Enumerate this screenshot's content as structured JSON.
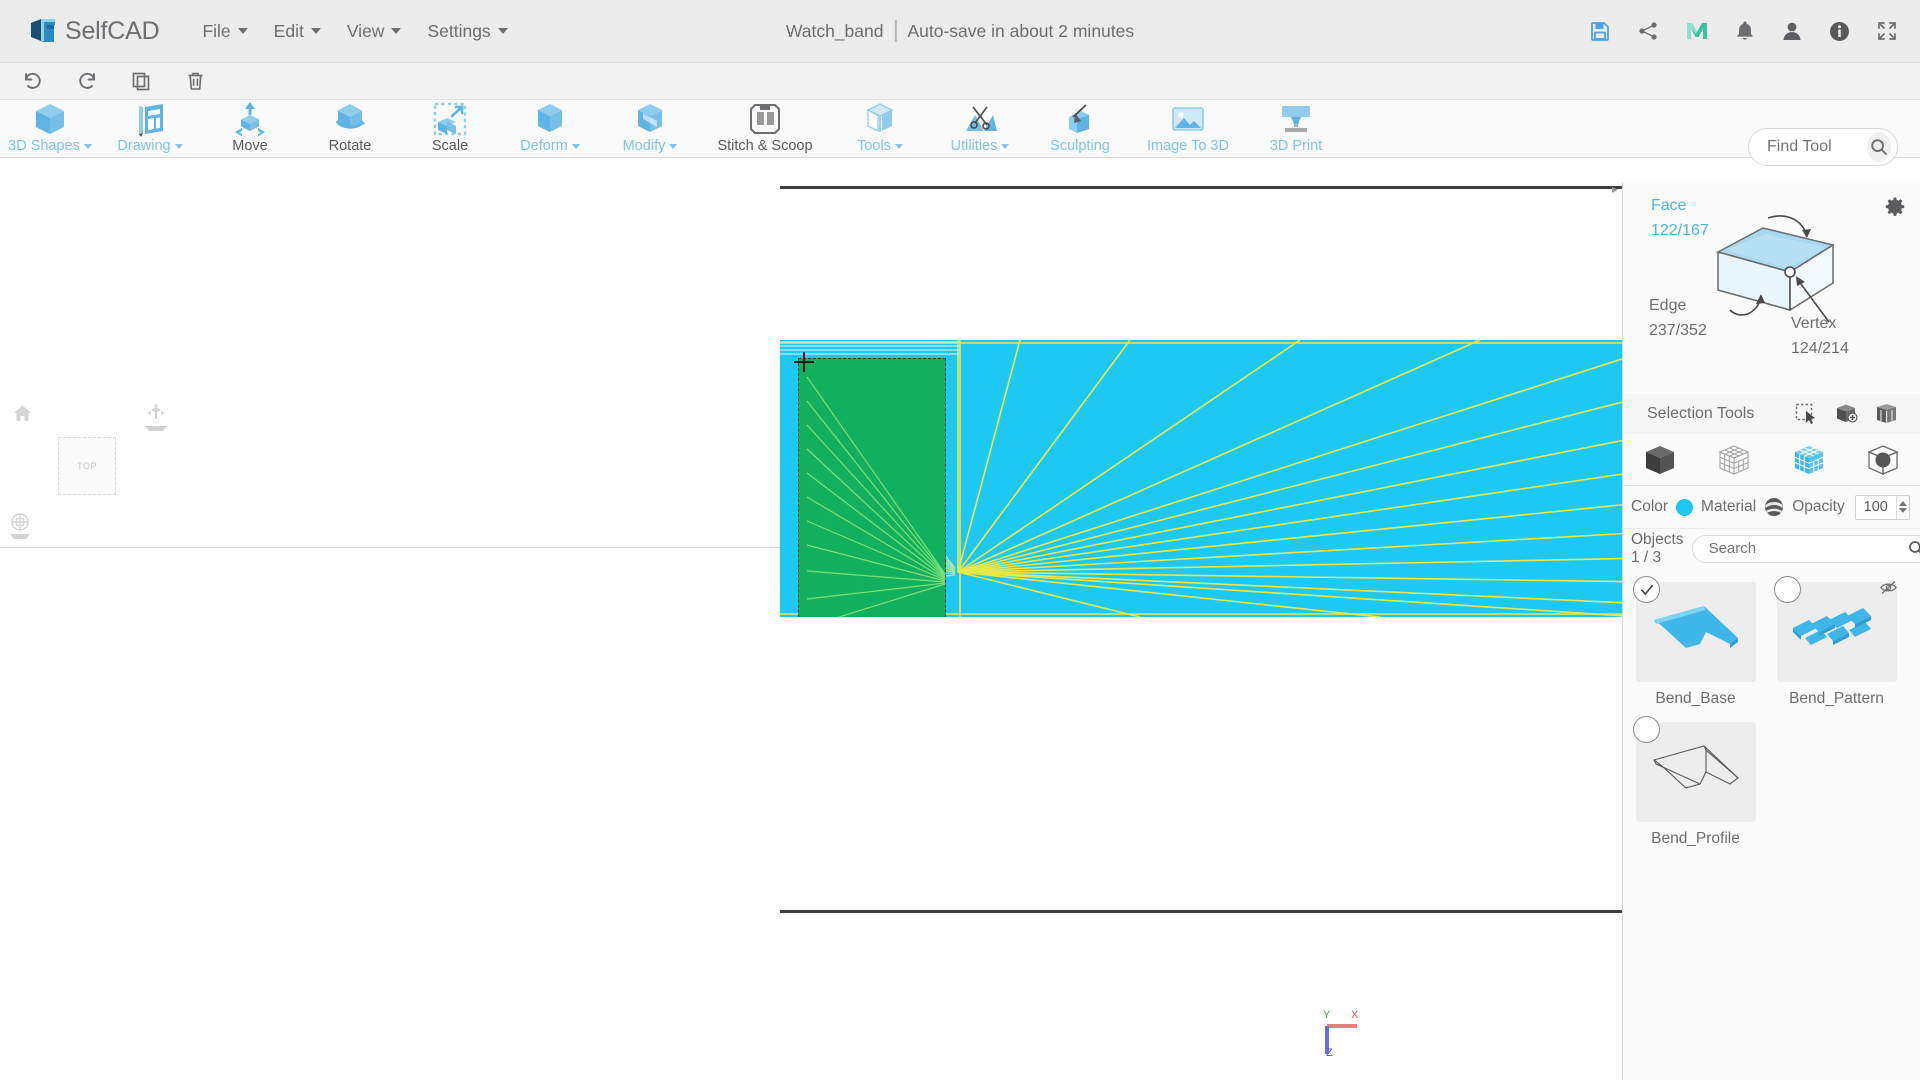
{
  "app": {
    "brand": "SelfCAD",
    "menu": [
      {
        "label": "File",
        "has_caret": true
      },
      {
        "label": "Edit",
        "has_caret": true
      },
      {
        "label": "View",
        "has_caret": true
      },
      {
        "label": "Settings",
        "has_caret": true
      }
    ],
    "document": {
      "name": "Watch_band",
      "autosave": "Auto-save in about 2 minutes"
    },
    "header_icons": [
      {
        "name": "save-icon",
        "title": "Save"
      },
      {
        "name": "share-icon",
        "title": "Share"
      },
      {
        "name": "myminifactory-icon",
        "title": "M"
      },
      {
        "name": "notifications-bell-icon",
        "title": "Notifications"
      },
      {
        "name": "user-account-icon",
        "title": "Account"
      },
      {
        "name": "info-icon",
        "title": "Info"
      },
      {
        "name": "fullscreen-icon",
        "title": "Fullscreen"
      }
    ]
  },
  "editbar": [
    {
      "name": "undo-icon",
      "label": "Undo"
    },
    {
      "name": "redo-icon",
      "label": "Redo"
    },
    {
      "name": "duplicate-icon",
      "label": "Duplicate"
    },
    {
      "name": "delete-trash-icon",
      "label": "Delete"
    }
  ],
  "toolbar": {
    "tools": [
      {
        "label": "3D Shapes",
        "icon": "cube-icon",
        "caret": true,
        "dark": false
      },
      {
        "label": "Drawing",
        "icon": "drawing-pencil-icon",
        "caret": true,
        "dark": false
      },
      {
        "label": "Move",
        "icon": "move-arrows-icon",
        "caret": false,
        "dark": true
      },
      {
        "label": "Rotate",
        "icon": "rotate-cube-icon",
        "caret": false,
        "dark": true
      },
      {
        "label": "Scale",
        "icon": "scale-cube-icon",
        "caret": false,
        "dark": true
      },
      {
        "label": "Deform",
        "icon": "deform-cube-icon",
        "caret": true,
        "dark": false
      },
      {
        "label": "Modify",
        "icon": "modify-cube-icon",
        "caret": true,
        "dark": false
      },
      {
        "label": "Stitch & Scoop",
        "icon": "stitch-scoop-icon",
        "caret": false,
        "dark": true
      },
      {
        "label": "Tools",
        "icon": "tools-cube-icon",
        "caret": true,
        "dark": false
      },
      {
        "label": "Utilities",
        "icon": "utilities-scissors-icon",
        "caret": true,
        "dark": false
      },
      {
        "label": "Sculpting",
        "icon": "sculpting-brush-icon",
        "caret": false,
        "dark": false
      },
      {
        "label": "Image To 3D",
        "icon": "image-to-3d-icon",
        "caret": false,
        "dark": false
      },
      {
        "label": "3D Print",
        "icon": "3d-print-icon",
        "caret": false,
        "dark": false
      }
    ],
    "find_tool": {
      "placeholder": "Find Tool",
      "value": ""
    }
  },
  "viewport": {
    "view_cube_label": "TOP",
    "axis": {
      "x": "X",
      "y": "Y",
      "z": "Z",
      "x_color": "#e06666",
      "y_color": "#49a349",
      "z_color": "#5b5bd6"
    },
    "model_color": "#1ec8f5",
    "selection_color": "#12b05e",
    "wireframe_color": "#e8e84a"
  },
  "right_panel": {
    "selection": {
      "face_label": "Face",
      "face_count": "122/167",
      "edge_label": "Edge",
      "edge_count": "237/352",
      "vertex_label": "Vertex",
      "vertex_count": "124/214",
      "gear_icon": "settings-gear-icon",
      "accent_color": "#50b4e3"
    },
    "selection_tools": {
      "label": "Selection Tools",
      "tools": [
        {
          "name": "rectangle-select-icon"
        },
        {
          "name": "add-selection-icon"
        },
        {
          "name": "through-selection-icon"
        }
      ]
    },
    "modes": [
      {
        "name": "object-mode-icon",
        "active": false
      },
      {
        "name": "vertex-mode-icon",
        "active": false
      },
      {
        "name": "face-mode-icon",
        "active": true
      },
      {
        "name": "edge-mode-icon",
        "active": false
      }
    ],
    "properties": {
      "color_label": "Color",
      "color_value": "#1ec8f5",
      "material_label": "Material",
      "material_icon": "material-sphere-icon",
      "opacity_label": "Opacity",
      "opacity_value": "100"
    },
    "objects": {
      "count_label": "Objects 1 / 3",
      "search_placeholder": "Search",
      "search_value": "",
      "search_icon": "search-icon",
      "gear_icon": "settings-gear-icon",
      "items": [
        {
          "name": "Bend_Base",
          "checked": true,
          "hidden": false,
          "thumb": "solid-band"
        },
        {
          "name": "Bend_Pattern",
          "checked": false,
          "hidden": true,
          "thumb": "pattern-pieces"
        },
        {
          "name": "Bend_Profile",
          "checked": false,
          "hidden": false,
          "thumb": "wireframe-band"
        }
      ]
    }
  }
}
